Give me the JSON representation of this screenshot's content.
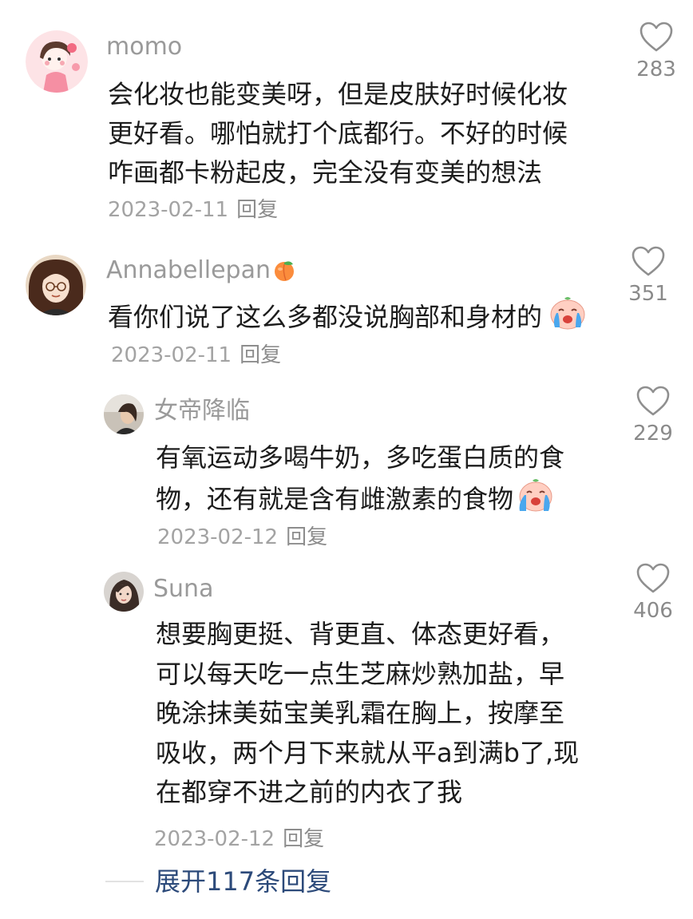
{
  "comments": [
    {
      "username": "momo",
      "lines": [
        "会化妆也能变美呀，但是皮肤好时候化妆",
        "更好看。哪怕就打个底都行。不好的时候",
        "咋画都卡粉起皮，完全没有变美的想法"
      ],
      "date": "2023-02-11",
      "reply_label": "回复",
      "likes": "283"
    },
    {
      "username": "Annabellepan",
      "name_emoji": "peach-icon",
      "lines": [
        "看你们说了这么多都没说胸部和身材的"
      ],
      "line_emoji": "crying-face-icon",
      "date": "2023-02-11",
      "reply_label": "回复",
      "likes": "351"
    }
  ],
  "replies": [
    {
      "username": "女帝降临",
      "lines": [
        "有氧运动多喝牛奶，多吃蛋白质的食",
        "物，还有就是含有雌激素的食物"
      ],
      "line_emoji": "crying-face-icon",
      "date": "2023-02-12",
      "reply_label": "回复",
      "likes": "229"
    },
    {
      "username": "Suna",
      "lines": [
        "想要胸更挺、背更直、体态更好看，",
        "可以每天吃一点生芝麻炒熟加盐，早",
        "晚涂抹美茹宝美乳霜在胸上，按摩至",
        "吸收，两个月下来就从平a到满b了,现",
        "在都穿不进之前的内衣了我"
      ],
      "date": "2023-02-12",
      "reply_label": "回复",
      "likes": "406"
    }
  ],
  "expand_label": "展开117条回复",
  "colors": {
    "link": "#2c4a7a",
    "meta": "#a3a3a3",
    "text": "#1c1c1c"
  }
}
